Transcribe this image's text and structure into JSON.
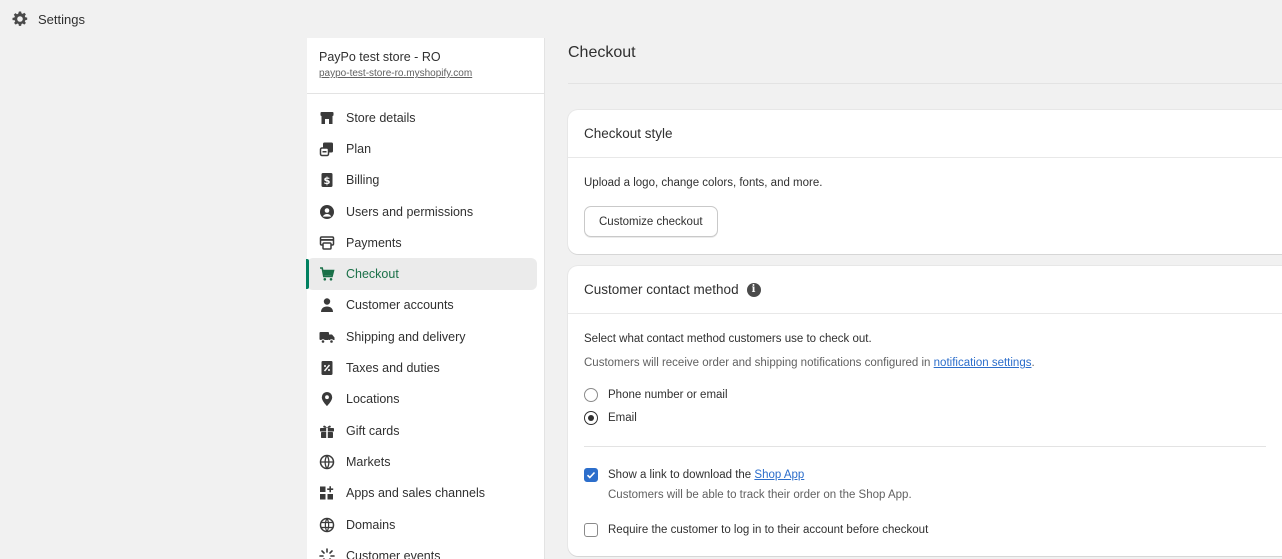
{
  "topbar": {
    "title": "Settings",
    "icon": "gear-icon"
  },
  "store": {
    "name": "PayPo test store - RO",
    "url": "paypo-test-store-ro.myshopify.com"
  },
  "nav": {
    "items": [
      {
        "label": "Store details",
        "icon": "store-icon"
      },
      {
        "label": "Plan",
        "icon": "plan-icon"
      },
      {
        "label": "Billing",
        "icon": "billing-icon"
      },
      {
        "label": "Users and permissions",
        "icon": "user-circle-icon"
      },
      {
        "label": "Payments",
        "icon": "payments-icon"
      },
      {
        "label": "Checkout",
        "icon": "cart-icon",
        "active": true
      },
      {
        "label": "Customer accounts",
        "icon": "person-icon"
      },
      {
        "label": "Shipping and delivery",
        "icon": "truck-icon"
      },
      {
        "label": "Taxes and duties",
        "icon": "receipt-icon"
      },
      {
        "label": "Locations",
        "icon": "location-pin-icon"
      },
      {
        "label": "Gift cards",
        "icon": "gift-icon"
      },
      {
        "label": "Markets",
        "icon": "globe-icon"
      },
      {
        "label": "Apps and sales channels",
        "icon": "apps-icon"
      },
      {
        "label": "Domains",
        "icon": "domain-globe-icon"
      },
      {
        "label": "Customer events",
        "icon": "events-icon"
      }
    ]
  },
  "main": {
    "title": "Checkout",
    "checkout_style": {
      "heading": "Checkout style",
      "description": "Upload a logo, change colors, fonts, and more.",
      "button": "Customize checkout"
    },
    "contact": {
      "heading": "Customer contact method",
      "line1": "Select what contact method customers use to check out.",
      "line2_prefix": "Customers will receive order and shipping notifications configured in ",
      "line2_link": "notification settings",
      "line2_suffix": ".",
      "option_phone": "Phone number or email",
      "option_email": "Email",
      "selected": "Email",
      "shop_app_prefix": "Show a link to download the ",
      "shop_app_link": "Shop App",
      "shop_app_checked": true,
      "shop_app_help": "Customers will be able to track their order on the Shop App.",
      "require_login": "Require the customer to log in to their account before checkout",
      "require_login_checked": false
    }
  },
  "colors": {
    "accent": "#008060",
    "link": "#2c6ecb",
    "background": "#f1f1f1"
  }
}
